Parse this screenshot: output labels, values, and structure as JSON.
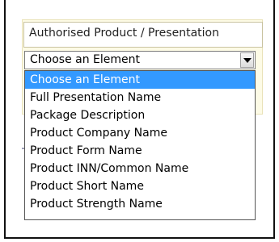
{
  "panel": {
    "title": "Authorised Product / Presentation"
  },
  "select": {
    "value": "Choose an Element",
    "arrow_icon": "chevron-down-icon"
  },
  "dropdown": {
    "options": [
      "Choose an Element",
      "Full Presentation Name",
      "Package Description",
      "Product Company Name",
      "Product Form Name",
      "Product INN/Common Name",
      "Product Short Name",
      "Product Strength Name"
    ],
    "selected_index": 0
  },
  "colors": {
    "highlight": "#3399ff",
    "panel_bg": "#fdfbe6",
    "frame_border": "#111111"
  }
}
